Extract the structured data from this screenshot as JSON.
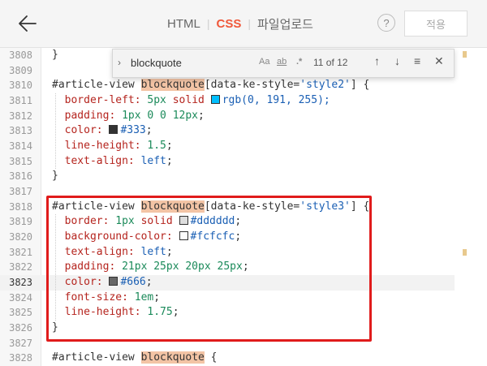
{
  "header": {
    "tabs": [
      {
        "label": "HTML",
        "active": false
      },
      {
        "label": "CSS",
        "active": true
      },
      {
        "label": "파일업로드",
        "active": false
      }
    ],
    "help_label": "?",
    "apply_label": "적용"
  },
  "find": {
    "query": "blockquote",
    "case_label": "Aa",
    "word_label": "ab",
    "regex_label": ".*",
    "count_text": "11 of 12"
  },
  "editor": {
    "current_line": "3823",
    "lines": [
      {
        "n": "3808",
        "parts": [
          {
            "t": "}",
            "c": "kw"
          }
        ]
      },
      {
        "n": "3809",
        "parts": []
      },
      {
        "n": "3810",
        "parts": [
          {
            "t": "#article-view ",
            "c": "kw"
          },
          {
            "t": "blockquote",
            "c": "hl"
          },
          {
            "t": "[data-ke-style=",
            "c": "kw"
          },
          {
            "t": "'style2'",
            "c": "str"
          },
          {
            "t": "] {",
            "c": "kw"
          }
        ]
      },
      {
        "n": "3811",
        "parts": [
          {
            "t": "  border-left: ",
            "c": "prop"
          },
          {
            "t": "5px",
            "c": "num"
          },
          {
            "t": " solid ",
            "c": "prop"
          },
          {
            "t": "",
            "c": "swatch",
            "color": "#00bfff"
          },
          {
            "t": "rgb(0, 191, 255);",
            "c": "str"
          }
        ]
      },
      {
        "n": "3812",
        "parts": [
          {
            "t": "  padding: ",
            "c": "prop"
          },
          {
            "t": "1px 0 0 12px",
            "c": "num"
          },
          {
            "t": ";",
            "c": "kw"
          }
        ]
      },
      {
        "n": "3813",
        "parts": [
          {
            "t": "  color: ",
            "c": "prop"
          },
          {
            "t": "",
            "c": "swatch",
            "color": "#333333"
          },
          {
            "t": "#333",
            "c": "str"
          },
          {
            "t": ";",
            "c": "kw"
          }
        ]
      },
      {
        "n": "3814",
        "parts": [
          {
            "t": "  line-height: ",
            "c": "prop"
          },
          {
            "t": "1.5",
            "c": "num"
          },
          {
            "t": ";",
            "c": "kw"
          }
        ]
      },
      {
        "n": "3815",
        "parts": [
          {
            "t": "  text-align: ",
            "c": "prop"
          },
          {
            "t": "left",
            "c": "str"
          },
          {
            "t": ";",
            "c": "kw"
          }
        ]
      },
      {
        "n": "3816",
        "parts": [
          {
            "t": "}",
            "c": "kw"
          }
        ]
      },
      {
        "n": "3817",
        "parts": []
      },
      {
        "n": "3818",
        "parts": [
          {
            "t": "#article-view ",
            "c": "kw"
          },
          {
            "t": "blockquote",
            "c": "hl"
          },
          {
            "t": "[data-ke-style=",
            "c": "kw"
          },
          {
            "t": "'style3'",
            "c": "str"
          },
          {
            "t": "] {",
            "c": "kw"
          }
        ]
      },
      {
        "n": "3819",
        "parts": [
          {
            "t": "  border: ",
            "c": "prop"
          },
          {
            "t": "1px",
            "c": "num"
          },
          {
            "t": " solid ",
            "c": "prop"
          },
          {
            "t": "",
            "c": "swatch",
            "color": "#dddddd"
          },
          {
            "t": "#dddddd",
            "c": "str"
          },
          {
            "t": ";",
            "c": "kw"
          }
        ]
      },
      {
        "n": "3820",
        "parts": [
          {
            "t": "  background-color: ",
            "c": "prop"
          },
          {
            "t": "",
            "c": "swatch",
            "color": "#fcfcfc"
          },
          {
            "t": "#fcfcfc",
            "c": "str"
          },
          {
            "t": ";",
            "c": "kw"
          }
        ]
      },
      {
        "n": "3821",
        "parts": [
          {
            "t": "  text-align: ",
            "c": "prop"
          },
          {
            "t": "left",
            "c": "str"
          },
          {
            "t": ";",
            "c": "kw"
          }
        ]
      },
      {
        "n": "3822",
        "parts": [
          {
            "t": "  padding: ",
            "c": "prop"
          },
          {
            "t": "21px 25px 20px 25px",
            "c": "num"
          },
          {
            "t": ";",
            "c": "kw"
          }
        ]
      },
      {
        "n": "3823",
        "parts": [
          {
            "t": "  color: ",
            "c": "prop"
          },
          {
            "t": "",
            "c": "swatch",
            "color": "#666666"
          },
          {
            "t": "#666",
            "c": "str"
          },
          {
            "t": ";",
            "c": "kw"
          }
        ]
      },
      {
        "n": "3824",
        "parts": [
          {
            "t": "  font-size: ",
            "c": "prop"
          },
          {
            "t": "1em",
            "c": "num"
          },
          {
            "t": ";",
            "c": "kw"
          }
        ]
      },
      {
        "n": "3825",
        "parts": [
          {
            "t": "  line-height: ",
            "c": "prop"
          },
          {
            "t": "1.75",
            "c": "num"
          },
          {
            "t": ";",
            "c": "kw"
          }
        ]
      },
      {
        "n": "3826",
        "parts": [
          {
            "t": "}",
            "c": "kw"
          }
        ]
      },
      {
        "n": "3827",
        "parts": []
      },
      {
        "n": "3828",
        "parts": [
          {
            "t": "#article-view ",
            "c": "kw"
          },
          {
            "t": "blockquote",
            "c": "hl"
          },
          {
            "t": " {",
            "c": "kw"
          }
        ]
      }
    ]
  }
}
